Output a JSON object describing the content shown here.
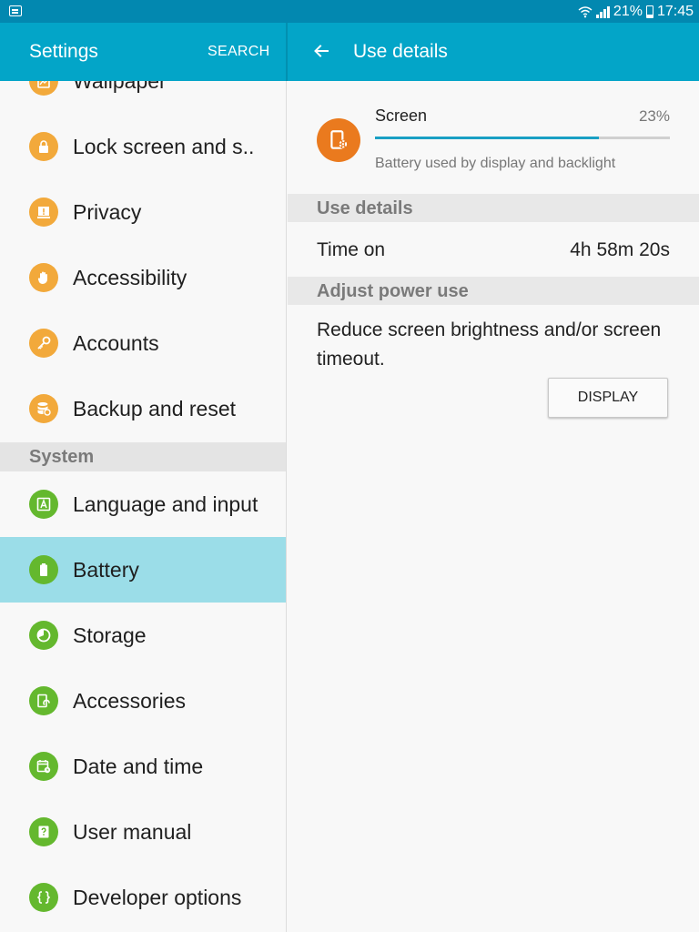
{
  "status_bar": {
    "battery_percent": "21%",
    "time": "17:45",
    "icons": [
      "notification-icon",
      "wifi-icon",
      "signal-icon",
      "battery-icon"
    ]
  },
  "action_bar": {
    "settings_title": "Settings",
    "search_label": "SEARCH",
    "detail_title": "Use details",
    "back_icon": "arrow-back-icon"
  },
  "sidebar": {
    "items": [
      {
        "label": "Wallpaper",
        "icon": "wallpaper-icon",
        "color": "#f2a93b"
      },
      {
        "label": "Lock screen and s..",
        "icon": "lock-icon",
        "color": "#f2a93b"
      },
      {
        "label": "Privacy",
        "icon": "privacy-icon",
        "color": "#f2a93b"
      },
      {
        "label": "Accessibility",
        "icon": "hand-icon",
        "color": "#f2a93b"
      },
      {
        "label": "Accounts",
        "icon": "key-icon",
        "color": "#f2a93b"
      },
      {
        "label": "Backup and reset",
        "icon": "backup-icon",
        "color": "#f2a93b"
      }
    ],
    "system_header": "System",
    "system_items": [
      {
        "label": "Language and input",
        "icon": "language-icon",
        "color": "#64b82e"
      },
      {
        "label": "Battery",
        "icon": "battery-icon",
        "color": "#64b82e",
        "selected": true
      },
      {
        "label": "Storage",
        "icon": "storage-icon",
        "color": "#64b82e"
      },
      {
        "label": "Accessories",
        "icon": "accessories-icon",
        "color": "#64b82e"
      },
      {
        "label": "Date and time",
        "icon": "calendar-icon",
        "color": "#64b82e"
      },
      {
        "label": "User manual",
        "icon": "help-icon",
        "color": "#64b82e"
      },
      {
        "label": "Developer options",
        "icon": "code-braces-icon",
        "color": "#64b82e"
      }
    ],
    "selected_color": "#9bdde8"
  },
  "detail": {
    "screen": {
      "label": "Screen",
      "percent": "23%",
      "usage_fraction": 0.76,
      "description": "Battery used by display and backlight",
      "icon": "screen-settings-icon",
      "icon_color": "#ea7a1e"
    },
    "use_details_header": "Use details",
    "time_on_label": "Time on",
    "time_on_value": "4h 58m 20s",
    "adjust_header": "Adjust power use",
    "adjust_text": "Reduce screen brightness and/or screen timeout.",
    "display_button": "DISPLAY"
  },
  "colors": {
    "status_bar": "#0288b0",
    "action_bar": "#03a5c8",
    "accent": "#1aa0c4"
  }
}
